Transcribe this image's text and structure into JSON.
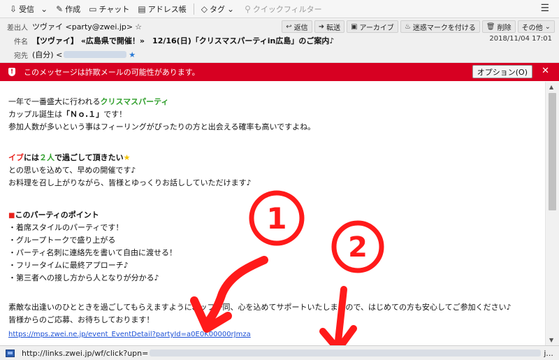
{
  "toolbar": {
    "receive": "受信",
    "compose": "作成",
    "chat": "チャット",
    "addressbook": "アドレス帳",
    "tags": "タグ",
    "quickfilter": "クイックフィルター"
  },
  "header": {
    "from_label": "差出人",
    "from_value": "ツヴァイ <party@zwei.jp>",
    "subject_label": "件名",
    "subject_value": "【ツヴァイ】 «広島県で開催！»　12/16(日)「クリスマスパーティin広島」のご案内♪",
    "to_label": "宛先",
    "to_value": "(自分) <",
    "date": "2018/11/04 17:01",
    "actions": [
      "返信",
      "転送",
      "アーカイブ",
      "迷惑マークを付ける",
      "削除",
      "その他"
    ]
  },
  "warning": {
    "text": "このメッセージは詐欺メールの可能性があります。",
    "option_button": "オプション(O)"
  },
  "body": {
    "l1a": "一年で一番盛大に行われる",
    "l1b": "クリスマスパーティ",
    "l2a": "カップル誕生は",
    "l2b": "「Ｎｏ.１」",
    "l2c": "です！",
    "l3": "参加人数が多いという事はフィーリングがぴったりの方と出会える確率も高いですよね。",
    "l4a": "イブ",
    "l4b": "には",
    "l4c": "２人",
    "l4d": "で過ごして頂きたい",
    "l5": "との思いを込めて、早めの開催です♪",
    "l6": "お料理を召し上がりながら、皆様とゆっくりお話ししていただけます♪",
    "points_title": "このパーティのポイント",
    "points": [
      "・着席スタイルのパーティです！",
      "・グループトークで盛り上がる",
      "・パーティ名刺に連絡先を書いて自由に渡せる！",
      "・フリータイムに最終アプローチ♪",
      "・第三者への接し方から人となりが分かる♪"
    ],
    "closing1": "素敵な出逢いのひとときを過ごしてもらえますように、ッフ一同、心を込めてサポートいたしますので、はじめての方も安心してご参加ください♪",
    "closing2": "皆様からのご応募、お待ちしております！",
    "link": "https://mps.zwei.ne.jp/event_EventDetail?partyId=a0E0K00000rJmza"
  },
  "annotations": {
    "mark1": "①",
    "mark2": "②",
    "arrow_color": "#ff1a1a"
  },
  "status": {
    "url": "http://links.zwei.jp/wf/click?upn=",
    "url_end": "j..."
  }
}
